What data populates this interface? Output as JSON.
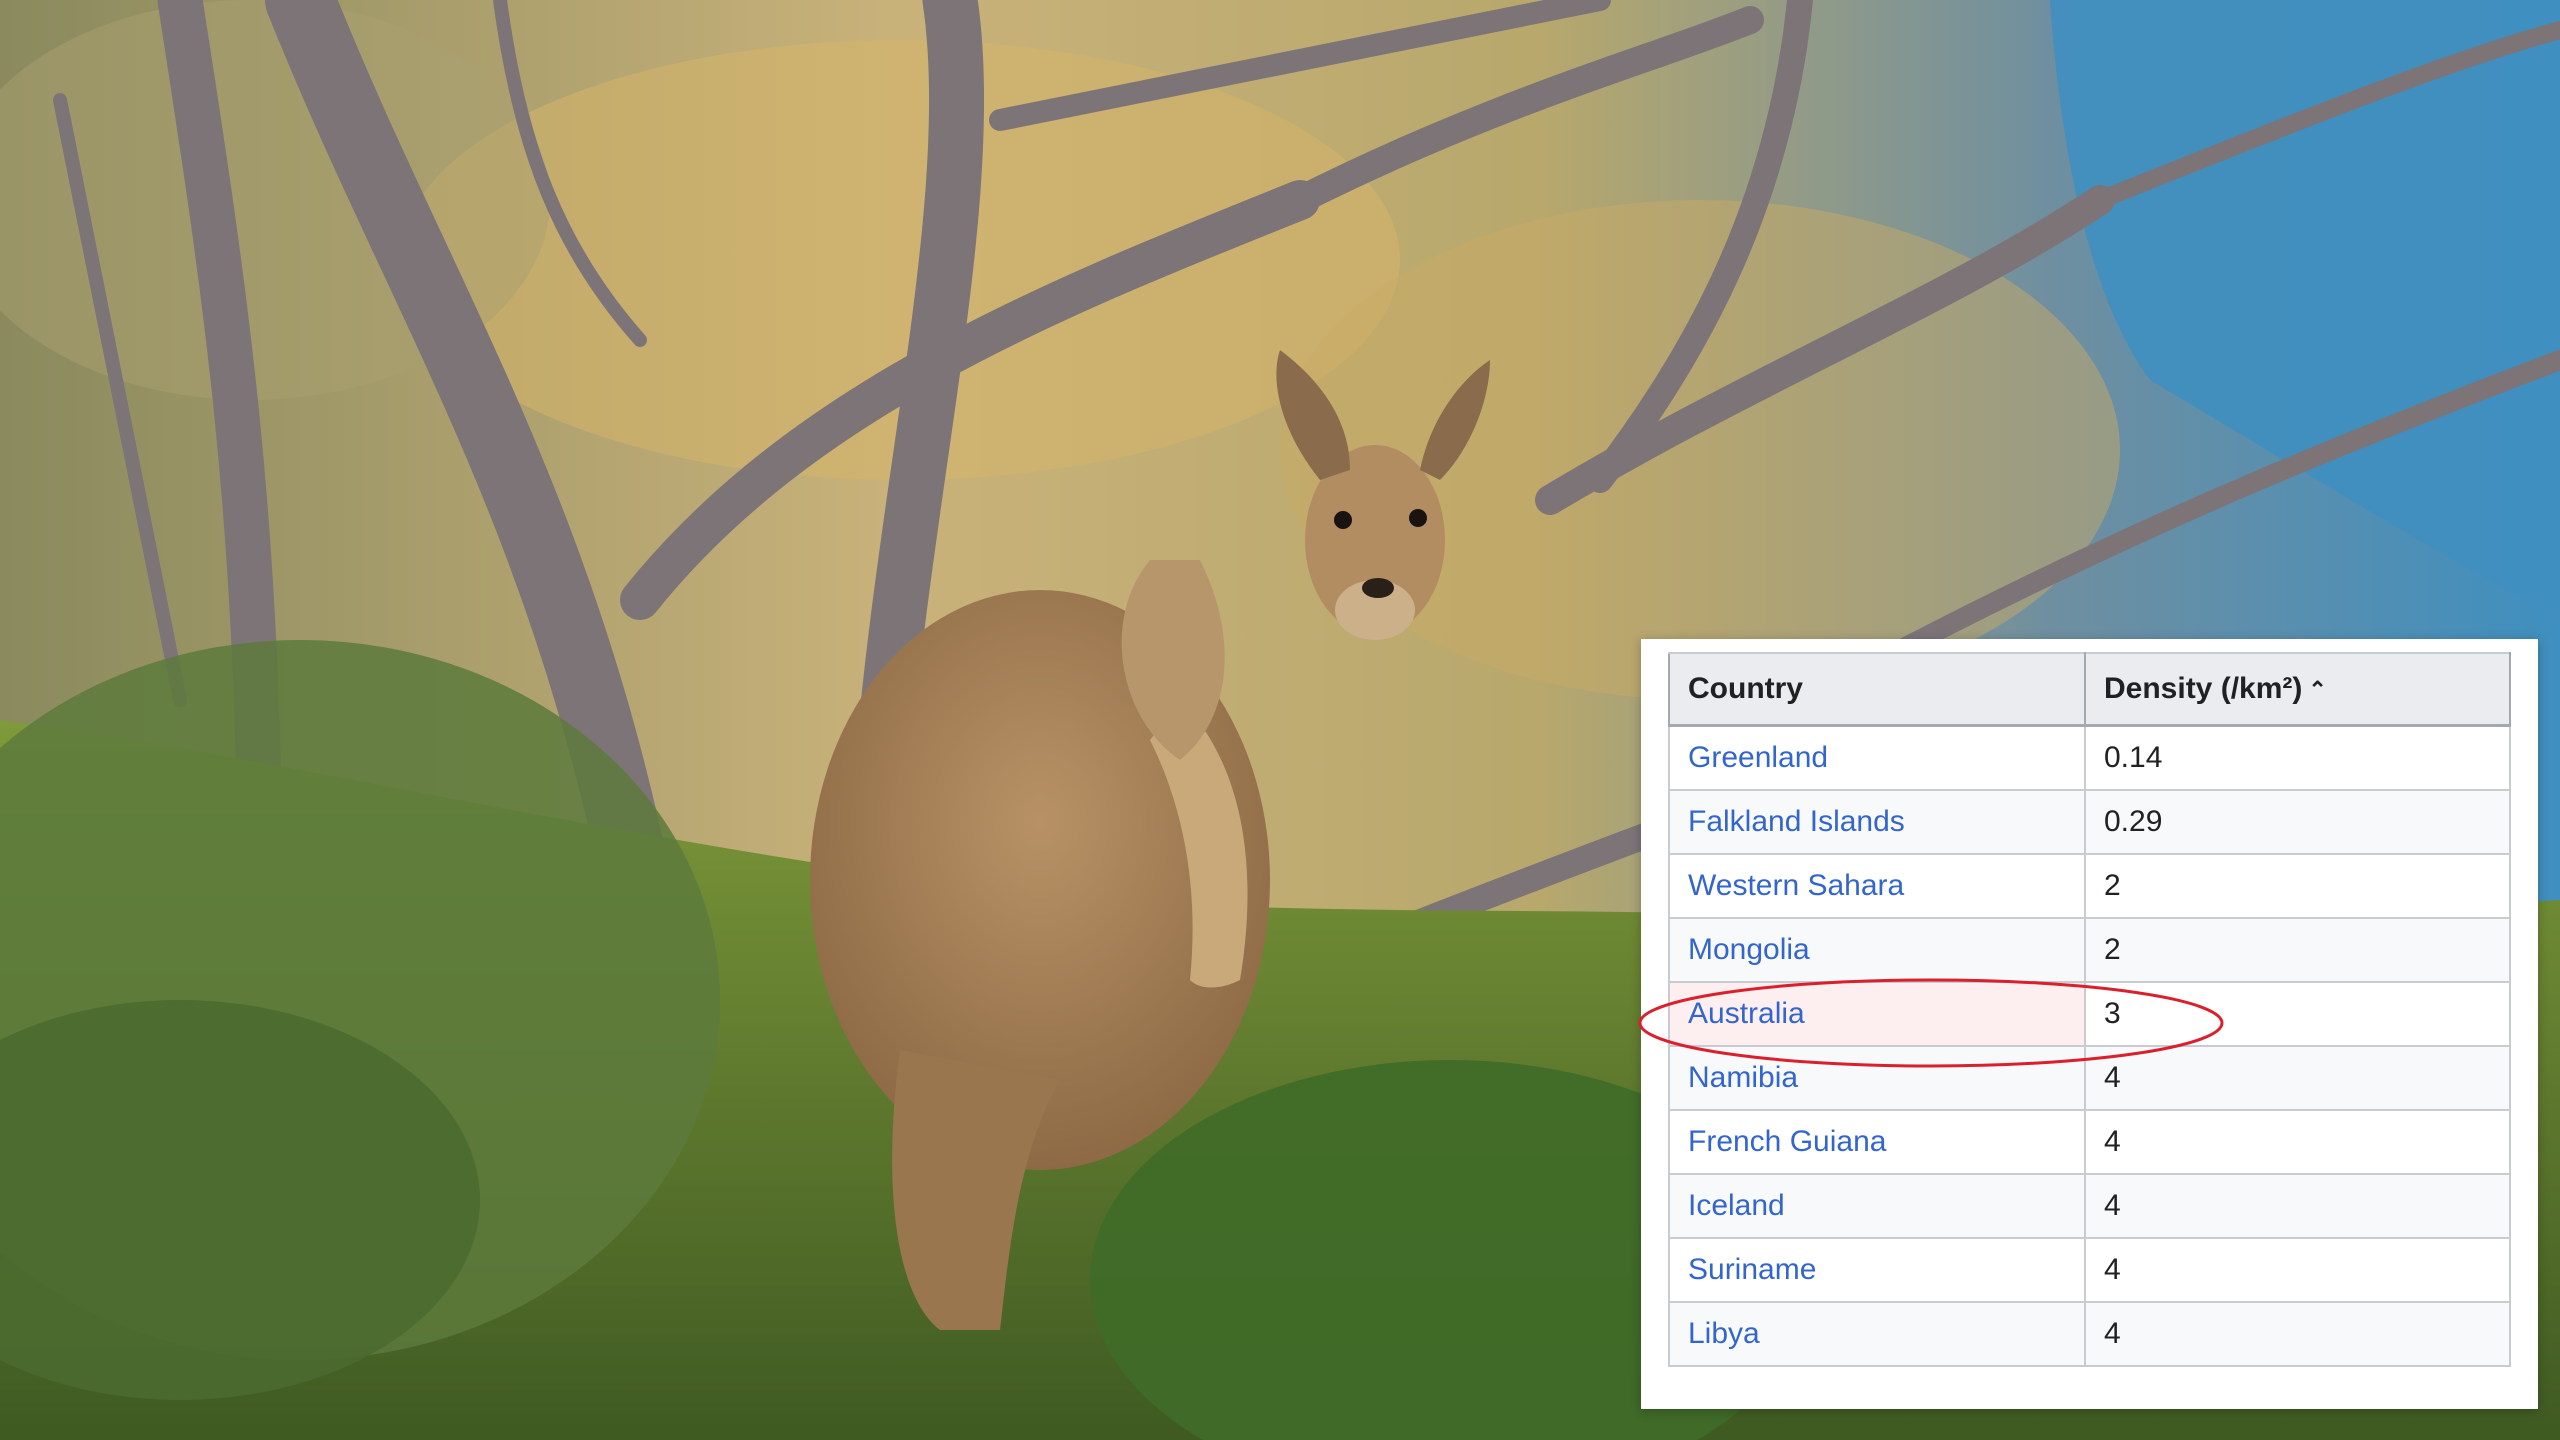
{
  "image": {
    "subject": "kangaroo-standing-among-trees",
    "colors": {
      "sky_water": "#3f8fc0",
      "foliage": "#7c8f3f",
      "grass": "#6c8a2e",
      "fur": "#a9835a",
      "branches": "#7d7478",
      "highlight_circle": "#d9202c"
    }
  },
  "table": {
    "headers": {
      "country": "Country",
      "density": "Density (/km²)"
    },
    "sort_icon": "caret-up-icon",
    "rows": [
      {
        "country": "Greenland",
        "density": "0.14"
      },
      {
        "country": "Falkland Islands",
        "density": "0.29"
      },
      {
        "country": "Western Sahara",
        "density": "2"
      },
      {
        "country": "Mongolia",
        "density": "2"
      },
      {
        "country": "Australia",
        "density": "3"
      },
      {
        "country": "Namibia",
        "density": "4"
      },
      {
        "country": "French Guiana",
        "density": "4"
      },
      {
        "country": "Iceland",
        "density": "4"
      },
      {
        "country": "Suriname",
        "density": "4"
      },
      {
        "country": "Libya",
        "density": "4"
      }
    ],
    "highlighted_country": "Australia"
  }
}
